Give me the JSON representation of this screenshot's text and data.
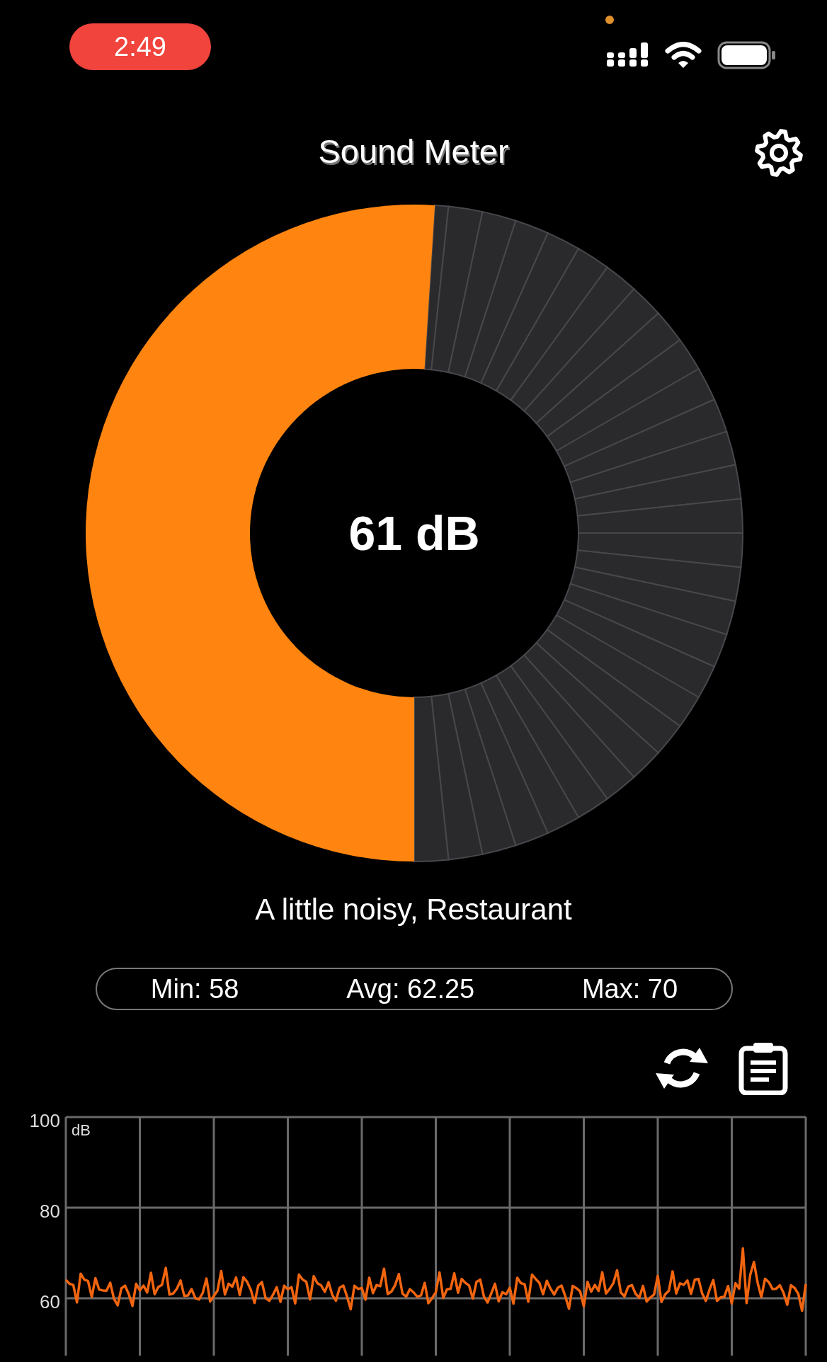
{
  "status_bar": {
    "time": "2:49"
  },
  "header": {
    "title": "Sound Meter"
  },
  "gauge": {
    "reading": "61 dB"
  },
  "description": "A little noisy, Restaurant",
  "stats": [
    "Min: 58",
    "Avg: 62.25",
    "Max: 70"
  ],
  "chart": {
    "unit": "dB",
    "y_labels": [
      "100",
      "80",
      "60"
    ]
  }
}
